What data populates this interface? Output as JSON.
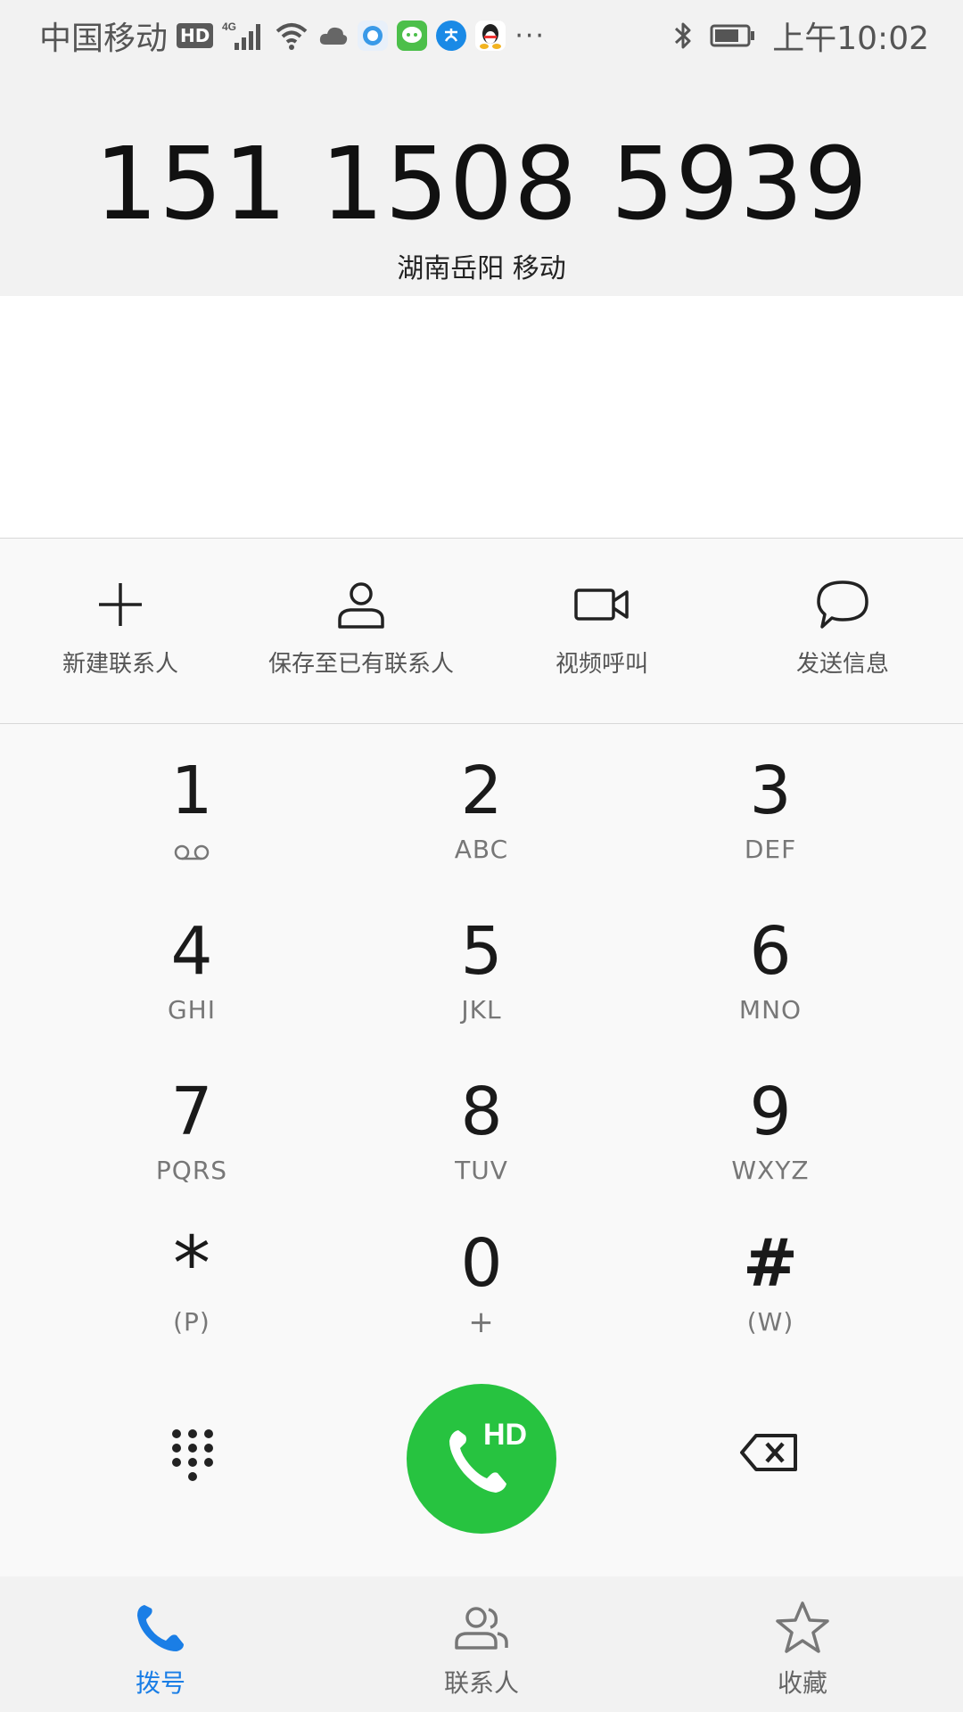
{
  "status_bar": {
    "carrier": "中国移动",
    "hd": "HD",
    "network": "4G",
    "time": "上午10:02",
    "more": "···"
  },
  "display": {
    "number": "151 1508 5939",
    "location": "湖南岳阳 移动"
  },
  "actions": [
    {
      "label": "新建联系人",
      "icon": "plus-icon"
    },
    {
      "label": "保存至已有联系人",
      "icon": "person-icon"
    },
    {
      "label": "视频呼叫",
      "icon": "video-camera-icon"
    },
    {
      "label": "发送信息",
      "icon": "message-bubble-icon"
    }
  ],
  "keypad": [
    {
      "digit": "1",
      "sub": ""
    },
    {
      "digit": "2",
      "sub": "ABC"
    },
    {
      "digit": "3",
      "sub": "DEF"
    },
    {
      "digit": "4",
      "sub": "GHI"
    },
    {
      "digit": "5",
      "sub": "JKL"
    },
    {
      "digit": "6",
      "sub": "MNO"
    },
    {
      "digit": "7",
      "sub": "PQRS"
    },
    {
      "digit": "8",
      "sub": "TUV"
    },
    {
      "digit": "9",
      "sub": "WXYZ"
    },
    {
      "digit": "*",
      "sub": "(P)"
    },
    {
      "digit": "0",
      "sub": "+"
    },
    {
      "digit": "#",
      "sub": "(W)"
    }
  ],
  "call_button": {
    "badge": "HD"
  },
  "bottom_nav": [
    {
      "label": "拨号",
      "icon": "phone-icon",
      "active": true
    },
    {
      "label": "联系人",
      "icon": "contacts-icon",
      "active": false
    },
    {
      "label": "收藏",
      "icon": "star-icon",
      "active": false
    }
  ],
  "colors": {
    "accent": "#1a7ee6",
    "call_green": "#27c340"
  }
}
